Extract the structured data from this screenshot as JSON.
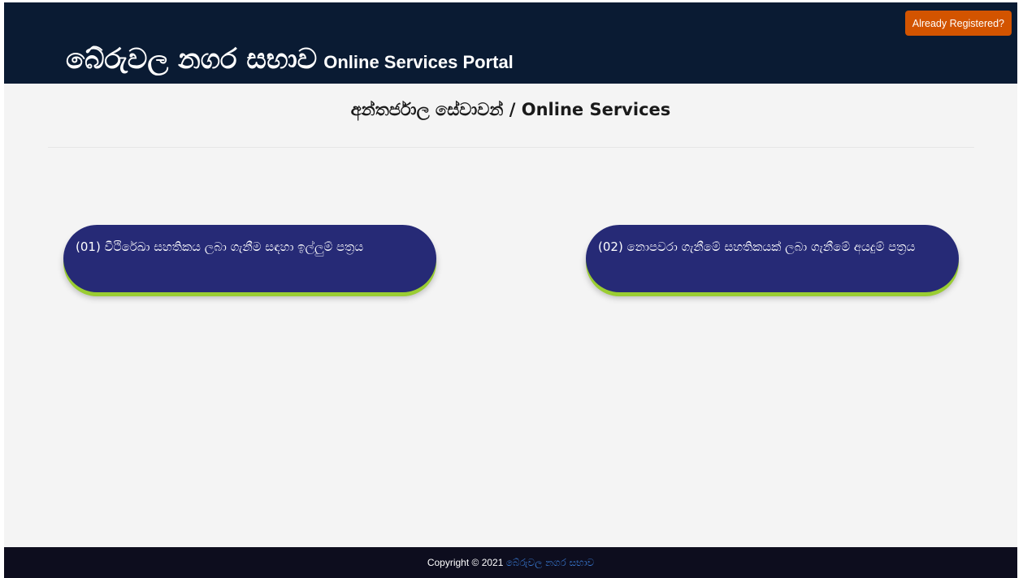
{
  "header": {
    "title_si": "බේරුවල නගර සභාව",
    "title_en": "Online Services Portal",
    "already_registered_label": "Already Registered?"
  },
  "main": {
    "section_title": "අන්තර්ජාල සේවාවන් / Online Services",
    "services": [
      {
        "label": "(01) වීථිරේඛා සහතිකය ලබා ගැනීම සඳහා ඉල්ලුම් පත්‍රය"
      },
      {
        "label": "(02) නොපවරා ගැනීමේ සහතිකයක් ලබා ගැනීමේ අයදුම් පත්‍රය"
      }
    ]
  },
  "footer": {
    "copyright": "Copyright © 2021",
    "link_text": "බේරුවල නගර සභාව"
  },
  "colors": {
    "header_bg": "#0a1b33",
    "button_accent": "#d35400",
    "card_bg": "#262a76",
    "card_shadow": "#9acd32",
    "footer_bg": "#0d0d1e",
    "footer_link": "#3a7bd5"
  }
}
